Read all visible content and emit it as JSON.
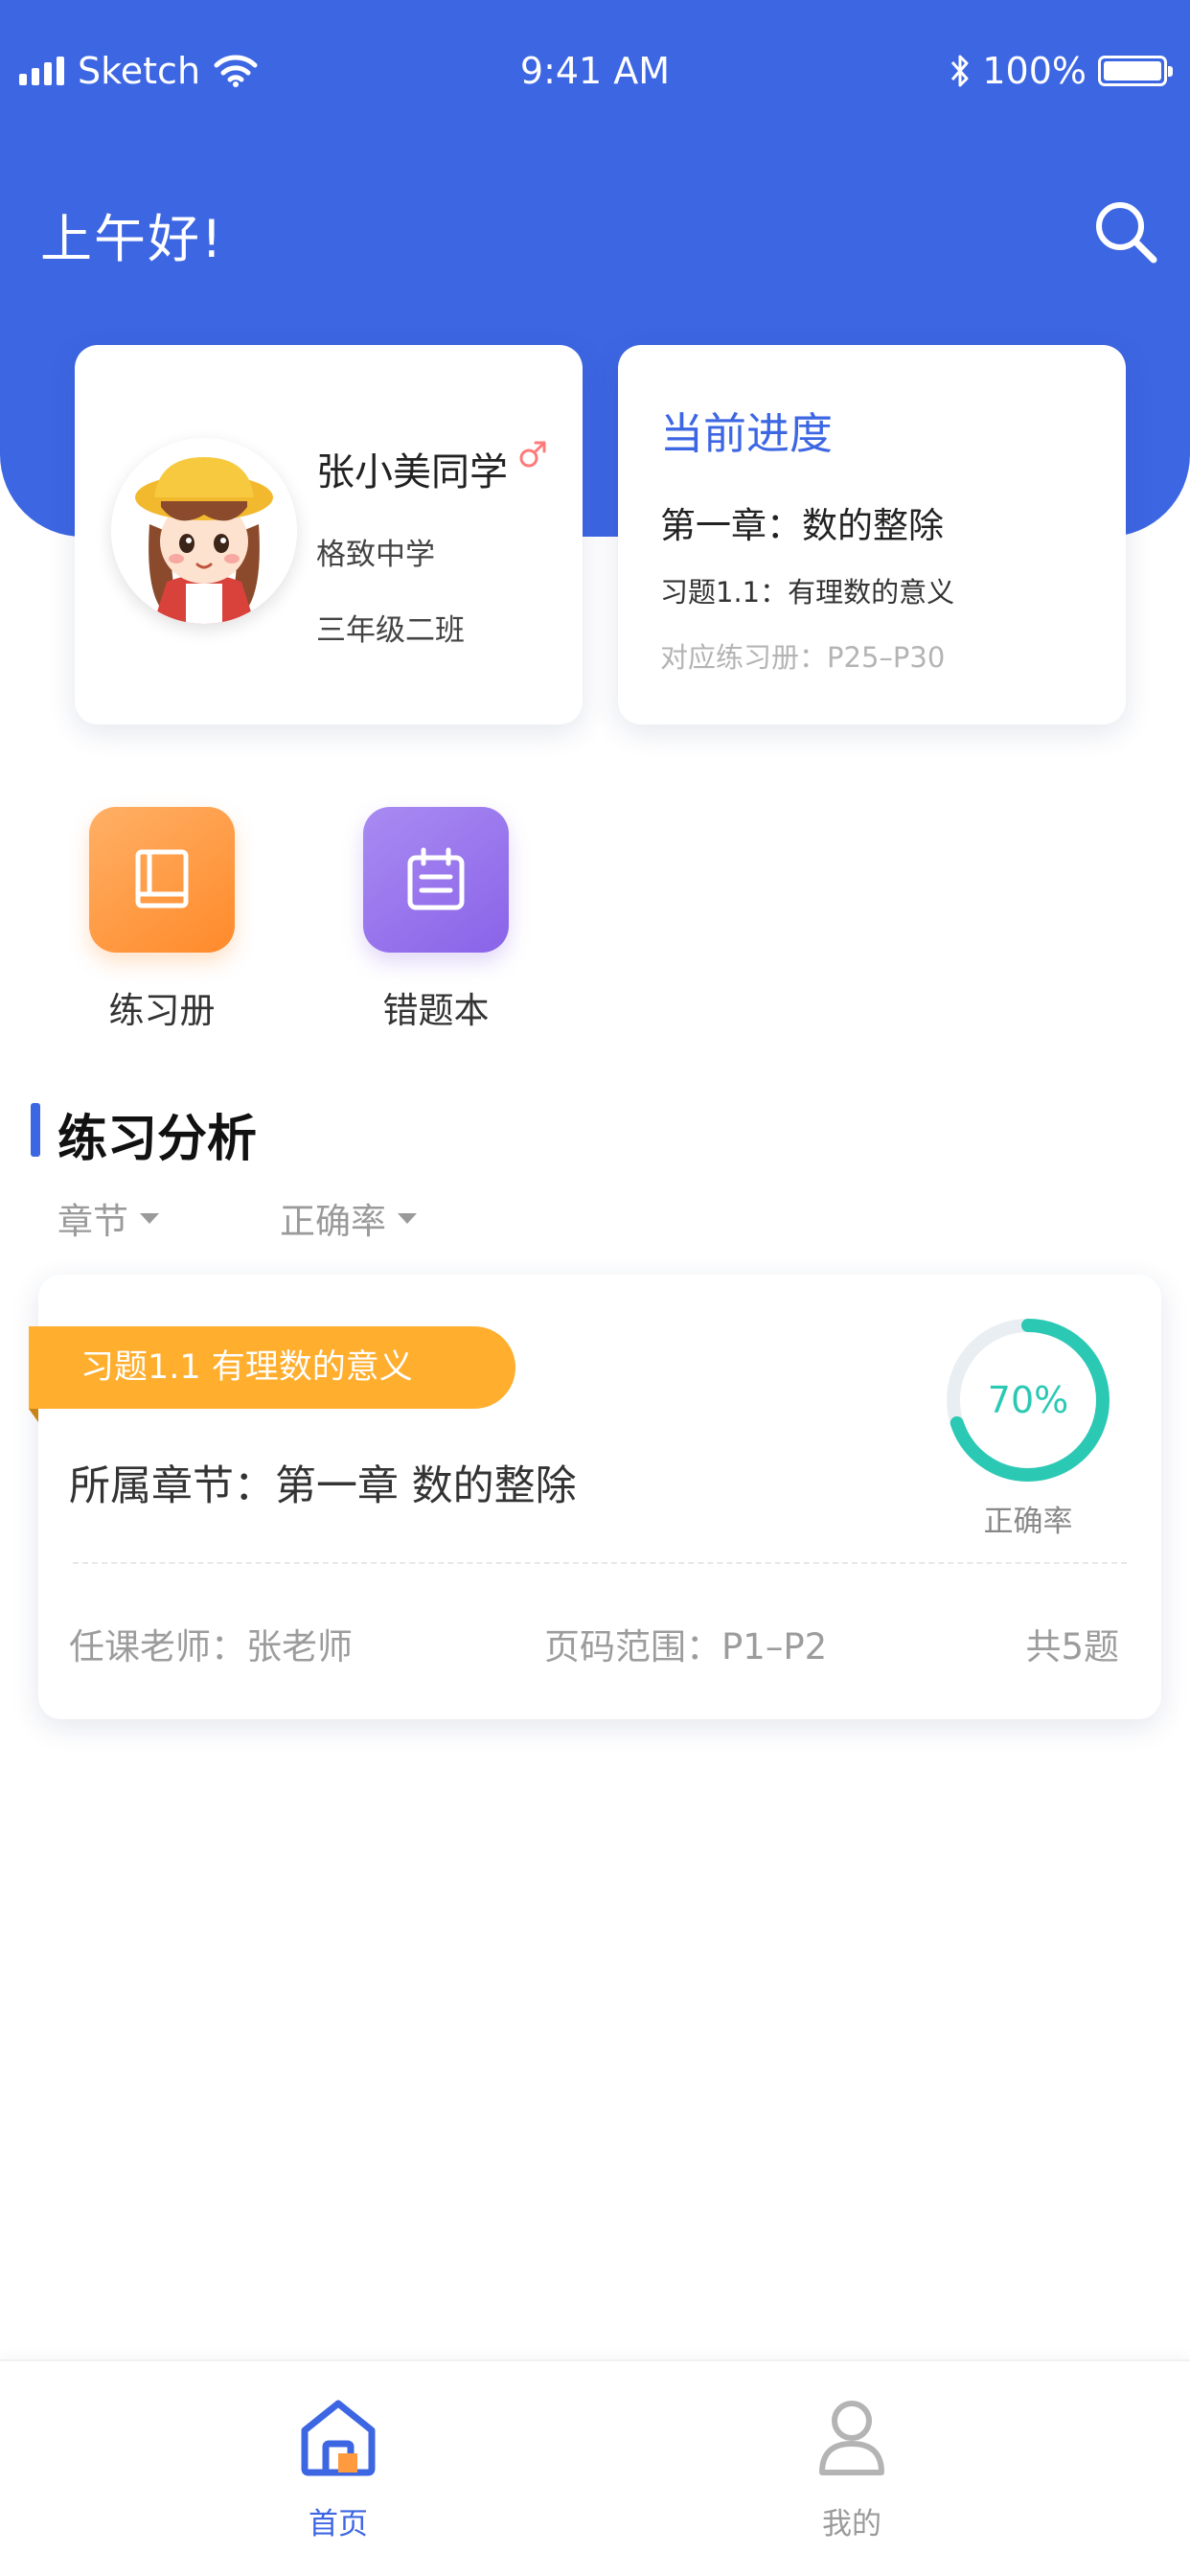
{
  "status_bar": {
    "carrier": "Sketch",
    "time": "9:41 AM",
    "battery": "100%",
    "battery_level": 1.0
  },
  "header": {
    "greeting": "上午好!",
    "search_icon": "search-icon"
  },
  "profile": {
    "name": "张小美同学",
    "gender_icon": "male-symbol-icon",
    "gender_color": "#ff7a7a",
    "school": "格致中学",
    "class": "三年级二班"
  },
  "progress": {
    "title": "当前进度",
    "chapter": "第一章：数的整除",
    "exercise": "习题1.1：有理数的意义",
    "workbook_pages": "对应练习册：P25–P30"
  },
  "quick_actions": [
    {
      "label": "练习册",
      "icon": "workbook-icon",
      "color": "#ff9a3f"
    },
    {
      "label": "错题本",
      "icon": "calendar-notebook-icon",
      "color": "#9270ec"
    }
  ],
  "analysis": {
    "title": "练习分析",
    "filters": [
      {
        "label": "章节"
      },
      {
        "label": "正确率"
      }
    ],
    "card": {
      "tag": "习题1.1 有理数的意义",
      "chapter": "所属章节：第一章 数的整除",
      "accuracy_percent": 70,
      "accuracy_text": "70%",
      "accuracy_label": "正确率",
      "teacher": "任课老师：张老师",
      "page_range": "页码范围：P1–P2",
      "total": "共5题"
    }
  },
  "tabbar": {
    "items": [
      {
        "label": "首页",
        "icon": "home-icon",
        "active": true
      },
      {
        "label": "我的",
        "icon": "person-icon",
        "active": false
      }
    ]
  },
  "colors": {
    "primary": "#3d66e3",
    "tag_orange": "#ffae2e",
    "ring_teal": "#2bc9b4"
  }
}
